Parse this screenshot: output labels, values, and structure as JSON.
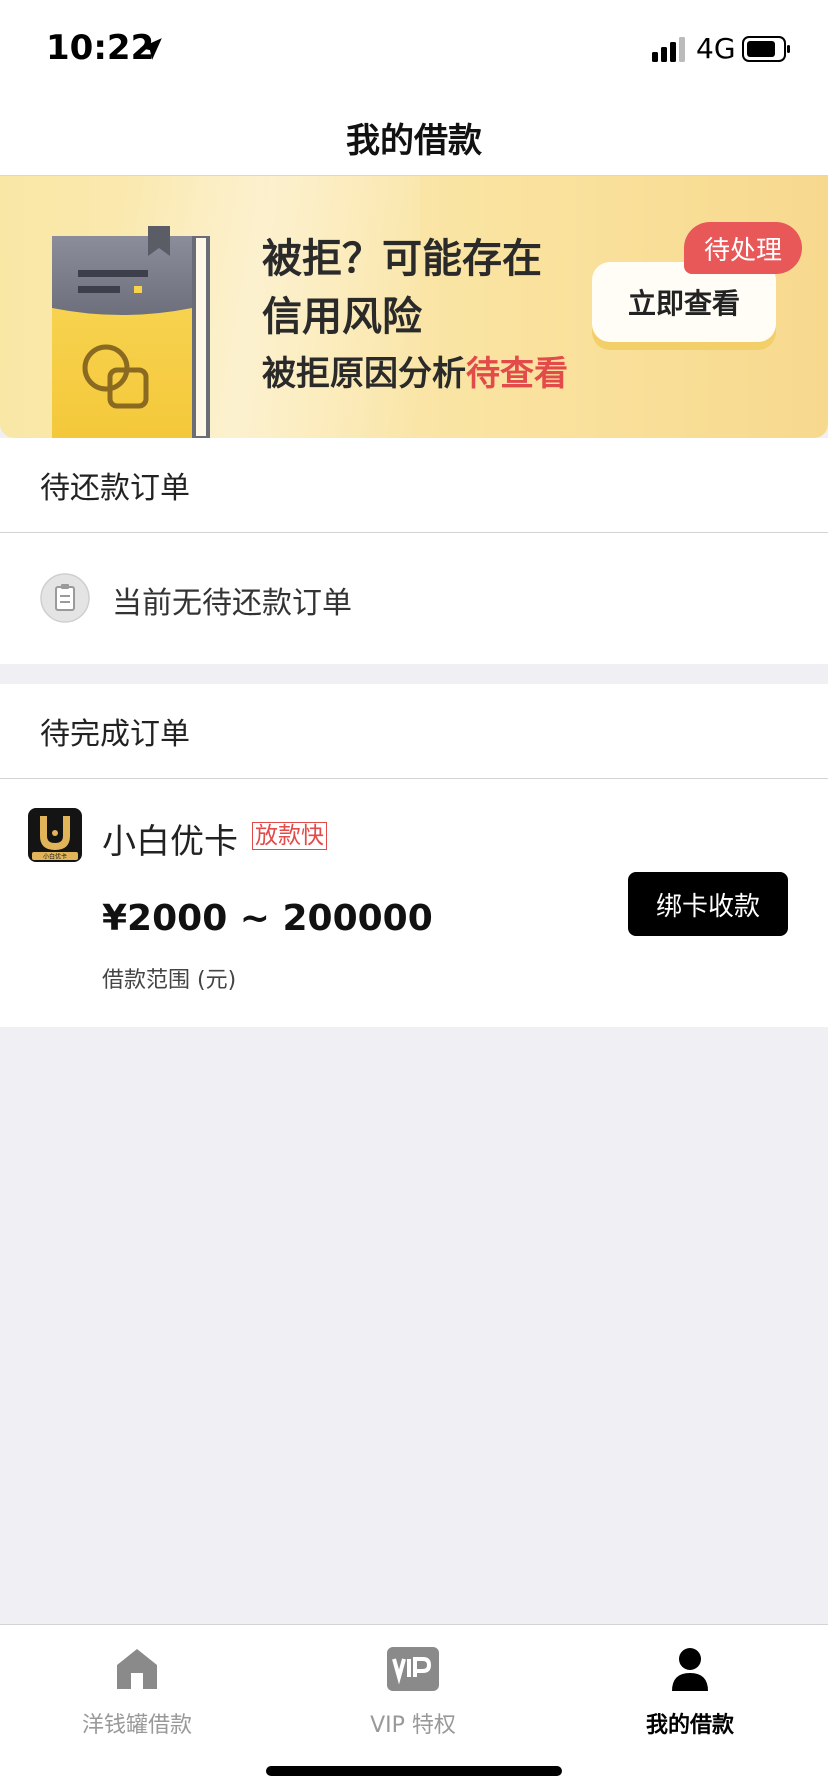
{
  "status_bar": {
    "time": "10:22",
    "network": "4G"
  },
  "header": {
    "title": "我的借款"
  },
  "banner": {
    "line1": "被拒？可能存在",
    "line2": "信用风险",
    "line3_prefix": "被拒原因分析",
    "line3_highlight": "待查看",
    "badge": "待处理",
    "button": "立即查看",
    "highlight_color": "#e34a4a"
  },
  "repay_section": {
    "title": "待还款订单",
    "empty_text": "当前无待还款订单"
  },
  "complete_section": {
    "title": "待完成订单",
    "order": {
      "app_name": "小白优卡",
      "logo_text": "小白优卡",
      "tag": "放款快",
      "amount": "¥2000 ~ 200000",
      "amount_label": "借款范围 (元)",
      "button": "绑卡收款"
    }
  },
  "tab_bar": {
    "items": [
      {
        "label": "洋钱罐借款",
        "icon": "home-icon",
        "active": false
      },
      {
        "label": "VIP 特权",
        "icon": "vip-icon",
        "active": false
      },
      {
        "label": "我的借款",
        "icon": "user-icon",
        "active": true
      }
    ]
  }
}
